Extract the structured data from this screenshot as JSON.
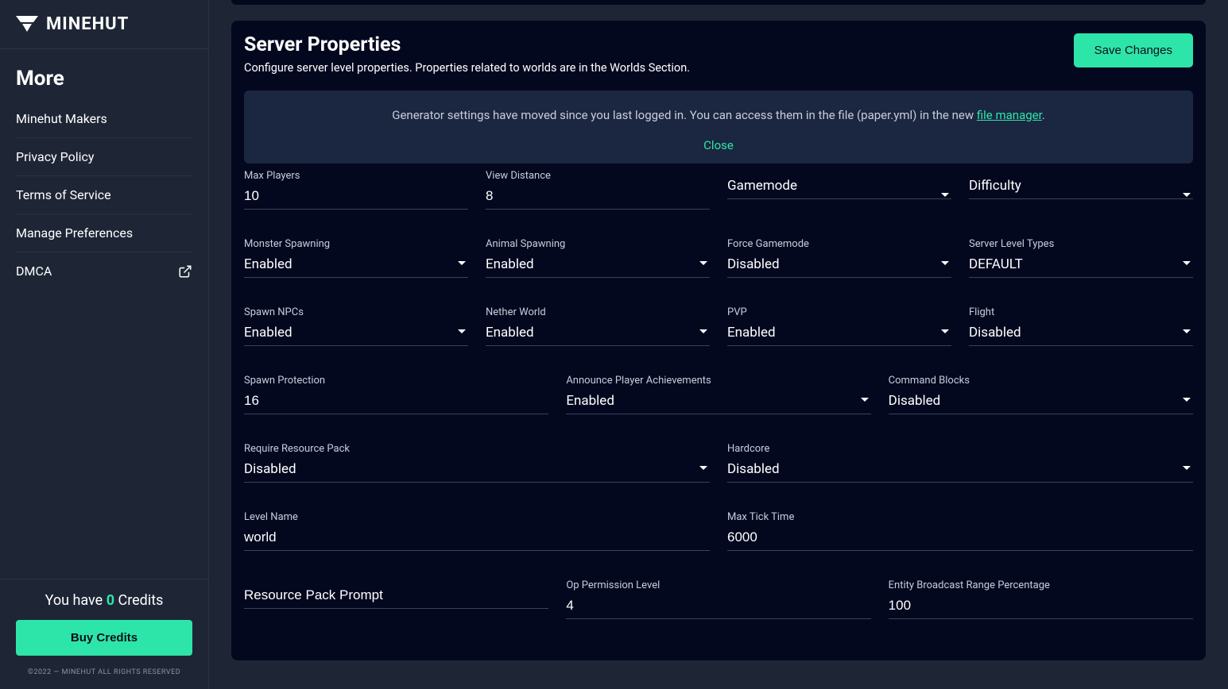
{
  "brand": {
    "name": "MINEHUT"
  },
  "sidebar": {
    "section_title": "More",
    "items": [
      {
        "label": "Minehut Makers"
      },
      {
        "label": "Privacy Policy"
      },
      {
        "label": "Terms of Service"
      },
      {
        "label": "Manage Preferences"
      },
      {
        "label": "DMCA"
      }
    ],
    "credits_prefix": "You have ",
    "credits_count": "0",
    "credits_suffix": " Credits",
    "buy_credits": "Buy Credits",
    "copyright": "©2022 — MINEHUT ALL RIGHTS RESERVED"
  },
  "panel": {
    "title": "Server Properties",
    "subtitle": "Configure server level properties. Properties related to worlds are in the Worlds Section.",
    "save_button": "Save Changes"
  },
  "notice": {
    "text_before": "Generator settings have moved since you last logged in. You can access them in the file (paper.yml) in the new ",
    "link_text": "file manager",
    "text_after": ".",
    "close": "Close"
  },
  "fields": {
    "max_players": {
      "label": "Max Players",
      "value": "10"
    },
    "view_distance": {
      "label": "View Distance",
      "value": "8"
    },
    "gamemode": {
      "label": "Gamemode",
      "value": "Gamemode"
    },
    "difficulty": {
      "label": "Difficulty",
      "value": "Difficulty"
    },
    "monster_spawning": {
      "label": "Monster Spawning",
      "value": "Enabled"
    },
    "animal_spawning": {
      "label": "Animal Spawning",
      "value": "Enabled"
    },
    "force_gamemode": {
      "label": "Force Gamemode",
      "value": "Disabled"
    },
    "server_level_types": {
      "label": "Server Level Types",
      "value": "DEFAULT"
    },
    "spawn_npcs": {
      "label": "Spawn NPCs",
      "value": "Enabled"
    },
    "nether_world": {
      "label": "Nether World",
      "value": "Enabled"
    },
    "pvp": {
      "label": "PVP",
      "value": "Enabled"
    },
    "flight": {
      "label": "Flight",
      "value": "Disabled"
    },
    "spawn_protection": {
      "label": "Spawn Protection",
      "value": "16"
    },
    "announce_achievements": {
      "label": "Announce Player Achievements",
      "value": "Enabled"
    },
    "command_blocks": {
      "label": "Command Blocks",
      "value": "Disabled"
    },
    "require_resource_pack": {
      "label": "Require Resource Pack",
      "value": "Disabled"
    },
    "hardcore": {
      "label": "Hardcore",
      "value": "Disabled"
    },
    "level_name": {
      "label": "Level Name",
      "value": "world"
    },
    "max_tick_time": {
      "label": "Max Tick Time",
      "value": "6000"
    },
    "resource_pack_prompt": {
      "label": "Resource Pack Prompt",
      "value": "Resource Pack Prompt"
    },
    "op_permission_level": {
      "label": "Op Permission Level",
      "value": "4"
    },
    "entity_broadcast_range": {
      "label": "Entity Broadcast Range Percentage",
      "value": "100"
    }
  }
}
